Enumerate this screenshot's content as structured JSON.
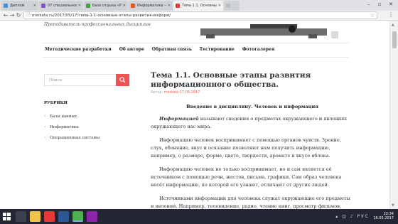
{
  "browser": {
    "tabs": [
      {
        "label": "Диплом",
        "color": "#4a90d9"
      },
      {
        "label": "07 специальное-часть-1-Т…",
        "color": "#7e57c2"
      },
      {
        "label": "База отдыха «Радуга» …",
        "color": "#43a047"
      },
      {
        "label": "Информатика – Мэнд…",
        "color": "#f4511e"
      },
      {
        "label": "Тема 1.1. Основные этап…",
        "color": "#e53935"
      },
      {
        "label": "",
        "color": "#bdbdbd"
      }
    ],
    "url": "minkata.ru/2017/05/17/тема-1-1-основные-этапы-развития-информ/"
  },
  "site": {
    "tagline": "Преподаватель профессиональных дисциплин",
    "nav": [
      "Методические разработки",
      "Об авторе",
      "Обратная связь",
      "Тестирование",
      "Фотогалерея"
    ]
  },
  "sidebar": {
    "search_placeholder": "Поиск",
    "rubrics_title": "РУБРИКИ",
    "rubrics": [
      "Базы данных",
      "Информатика",
      "Операционные системы"
    ]
  },
  "article": {
    "title": "Тема 1.1. Основные этапы развития информационного общества.",
    "meta_label": "Автор:",
    "author": "minkata",
    "date": "17.05.2017",
    "subhead": "Введение в дисциплину. Человек и информация",
    "p1_em": "Информацией",
    "p1_rest": " называют сведения о предметах окружающего и явлениях окружающего нас мира.",
    "p2": "Информацию человек воспринимает с помощью органов чувств. Зрение, слух, обоняние, вкус и осязание позволяют нам получить информацию, например, о размере, форме, цвете, твердости, аромате и вкусе яблока.",
    "p3": "Информацию человек не только воспринимает, но и сам является её источником с помощью речи, жестов, письма, графики. Сам образ человека несёт информацию, по которой его узнают, отличают от других людей.",
    "p4": "Источниками информации для человека служат окружающие его предметы и явления. Например, телевидение, радио, чтение книг, просмотр фильмов, разговоры"
  },
  "taskbar": {
    "apps": [
      {
        "icon": "taskview-icon",
        "color": "#3c4150"
      },
      {
        "icon": "explorer-icon",
        "color": "#f0c24b"
      },
      {
        "icon": "yandex-icon",
        "color": "#e53935"
      },
      {
        "icon": "word-icon",
        "color": "#2b5797"
      },
      {
        "icon": "chrome-icon",
        "color": "#4caf50"
      },
      {
        "icon": "app-icon",
        "color": "#8e24aa"
      }
    ],
    "lang": "РУС",
    "time": "22:34",
    "date": "16.05.2017"
  }
}
